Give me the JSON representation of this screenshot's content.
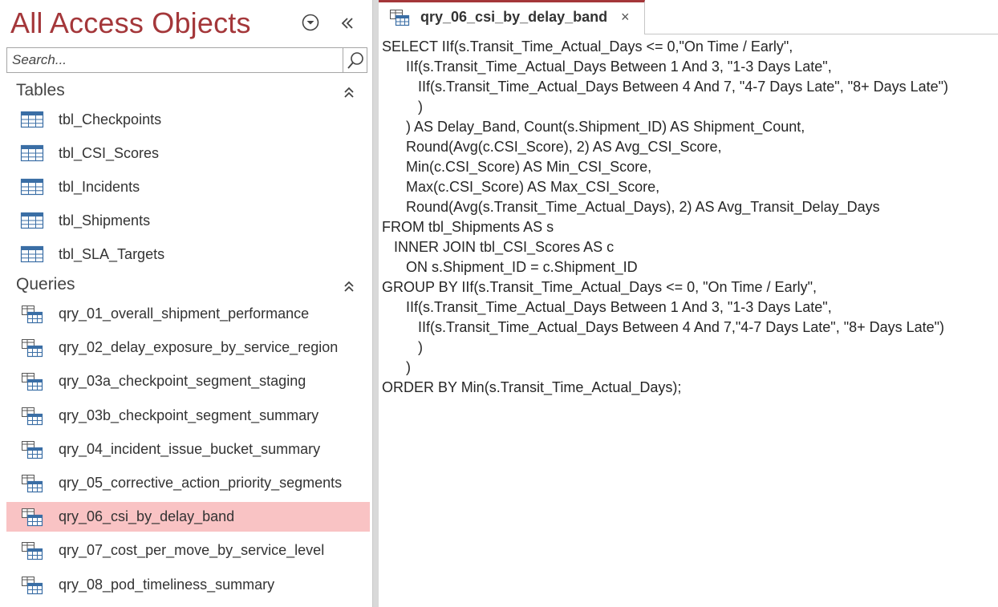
{
  "nav": {
    "title": "All Access Objects",
    "search_placeholder": "Search...",
    "groups": [
      {
        "label": "Tables",
        "items": [
          "tbl_Checkpoints",
          "tbl_CSI_Scores",
          "tbl_Incidents",
          "tbl_Shipments",
          "tbl_SLA_Targets"
        ]
      },
      {
        "label": "Queries",
        "items": [
          "qry_01_overall_shipment_performance",
          "qry_02_delay_exposure_by_service_region",
          "qry_03a_checkpoint_segment_staging",
          "qry_03b_checkpoint_segment_summary",
          "qry_04_incident_issue_bucket_summary",
          "qry_05_corrective_action_priority_segments",
          "qry_06_csi_by_delay_band",
          "qry_07_cost_per_move_by_service_level",
          "qry_08_pod_timeliness_summary"
        ]
      }
    ],
    "selected_item": "qry_06_csi_by_delay_band"
  },
  "tab": {
    "label": "qry_06_csi_by_delay_band",
    "close_glyph": "×"
  },
  "sql_lines": [
    "SELECT IIf(s.Transit_Time_Actual_Days <= 0,\"On Time / Early\",",
    "      IIf(s.Transit_Time_Actual_Days Between 1 And 3, \"1-3 Days Late\",",
    "         IIf(s.Transit_Time_Actual_Days Between 4 And 7, \"4-7 Days Late\", \"8+ Days Late\")",
    "         )",
    "      ) AS Delay_Band, Count(s.Shipment_ID) AS Shipment_Count,",
    "      Round(Avg(c.CSI_Score), 2) AS Avg_CSI_Score,",
    "      Min(c.CSI_Score) AS Min_CSI_Score,",
    "      Max(c.CSI_Score) AS Max_CSI_Score,",
    "      Round(Avg(s.Transit_Time_Actual_Days), 2) AS Avg_Transit_Delay_Days",
    "FROM tbl_Shipments AS s",
    "   INNER JOIN tbl_CSI_Scores AS c",
    "      ON s.Shipment_ID = c.Shipment_ID",
    "GROUP BY IIf(s.Transit_Time_Actual_Days <= 0, \"On Time / Early\",",
    "      IIf(s.Transit_Time_Actual_Days Between 1 And 3, \"1-3 Days Late\",",
    "         IIf(s.Transit_Time_Actual_Days Between 4 And 7,\"4-7 Days Late\", \"8+ Days Late\")",
    "         )",
    "      )",
    "ORDER BY Min(s.Transit_Time_Actual_Days);"
  ],
  "colors": {
    "accent": "#a4373a",
    "selected_bg": "#f9c3c4"
  },
  "icons": {
    "table": "table-icon",
    "query": "query-icon",
    "menu": "dropdown-circle-icon",
    "collapse": "double-chevron-left-icon",
    "search": "search-icon",
    "group_toggle": "double-chevron-up-icon"
  }
}
